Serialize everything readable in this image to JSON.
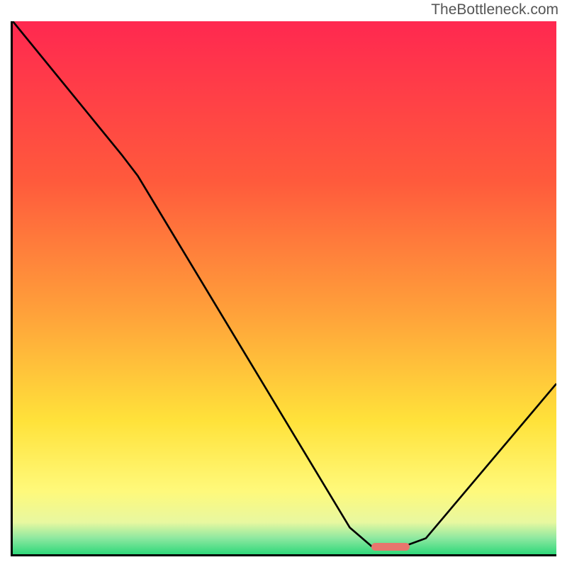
{
  "watermark": "TheBottleneck.com",
  "chart_data": {
    "type": "line",
    "title": "",
    "xlabel": "",
    "ylabel": "",
    "xlim": [
      0,
      100
    ],
    "ylim": [
      0,
      100
    ],
    "curve": [
      {
        "x": 0,
        "y": 100
      },
      {
        "x": 20,
        "y": 75
      },
      {
        "x": 23,
        "y": 71
      },
      {
        "x": 62,
        "y": 5
      },
      {
        "x": 66,
        "y": 1.5
      },
      {
        "x": 72,
        "y": 1.5
      },
      {
        "x": 76,
        "y": 3
      },
      {
        "x": 100,
        "y": 32
      }
    ],
    "marker": {
      "x_start": 66,
      "x_end": 73,
      "y": 1.5
    },
    "gradient_stops": [
      {
        "offset": 0,
        "color": "#ff2850"
      },
      {
        "offset": 30,
        "color": "#ff5a3c"
      },
      {
        "offset": 55,
        "color": "#ffa23a"
      },
      {
        "offset": 75,
        "color": "#ffe23a"
      },
      {
        "offset": 88,
        "color": "#fff97a"
      },
      {
        "offset": 94,
        "color": "#e8f8a0"
      },
      {
        "offset": 97,
        "color": "#8de8a0"
      },
      {
        "offset": 100,
        "color": "#2fd87a"
      }
    ]
  }
}
